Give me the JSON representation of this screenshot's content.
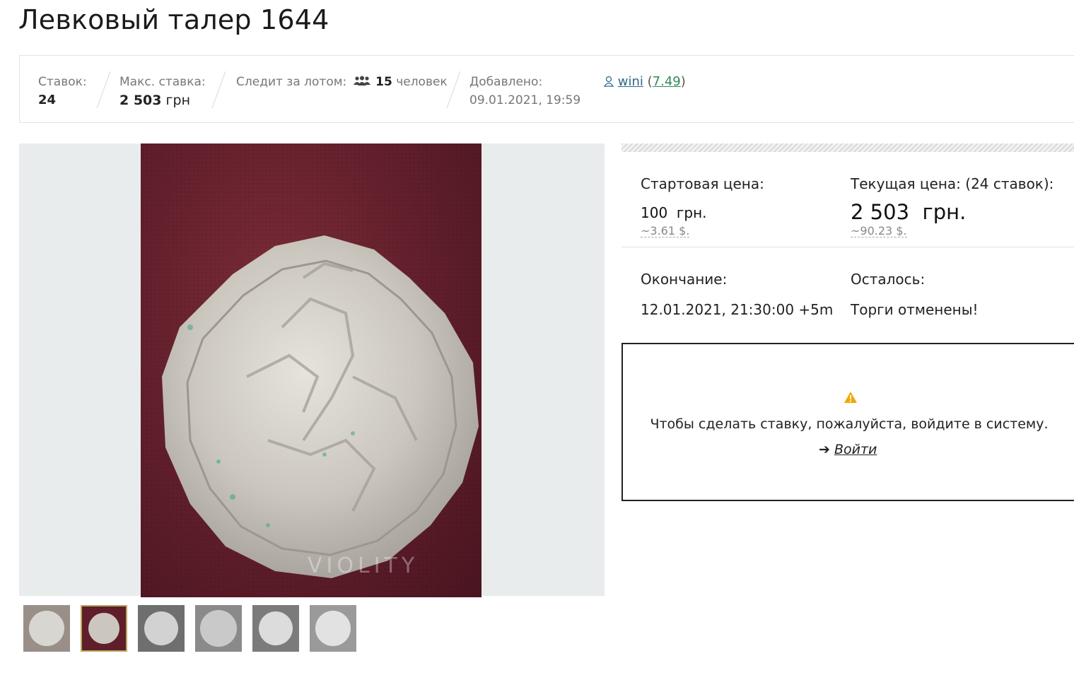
{
  "lot": {
    "title": "Левковый талер 1644"
  },
  "stats": {
    "bids_label": "Ставок:",
    "bids_value": "24",
    "max_bid_label": "Макс. ставка:",
    "max_bid_amount": "2 503",
    "max_bid_currency": "грн",
    "watchers_label": "Следит за лотом:",
    "watchers_count": "15",
    "watchers_unit": "человек",
    "added_label": "Добавлено:",
    "added_value": "09.01.2021, 19:59",
    "seller_name": "wini",
    "seller_rating": "7.49"
  },
  "gallery": {
    "watermark": "VIOLITY",
    "thumbnail_count": 6,
    "active_index": 1
  },
  "prices": {
    "start_label": "Стартовая цена:",
    "start_amount": "100",
    "start_currency": "грн.",
    "start_usd": "~3.61",
    "start_usd_unit": "$.",
    "current_label": "Текущая цена: (24 ставок):",
    "current_amount": "2 503",
    "current_currency": "грн.",
    "current_usd": "~90.23",
    "current_usd_unit": "$.",
    "end_label": "Окончание:",
    "end_value": "12.01.2021, 21:30:00 +5m",
    "left_label": "Осталось:",
    "left_value": "Торги отменены!"
  },
  "login": {
    "message": "Чтобы сделать ставку, пожалуйста, войдите в систему.",
    "link_label": "Войти"
  },
  "colors": {
    "link": "#2d6a8a",
    "rating": "#2e8b57",
    "warning": "#f0a800",
    "active_thumb_border": "#b7a860"
  }
}
